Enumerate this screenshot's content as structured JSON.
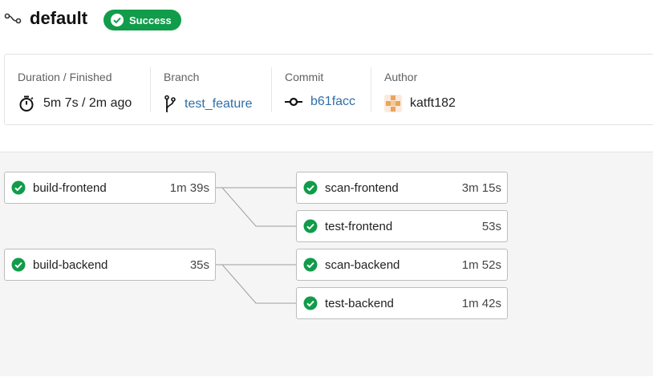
{
  "workflow": {
    "title": "default",
    "status_label": "Success"
  },
  "info": {
    "duration_label": "Duration / Finished",
    "duration_value": "5m 7s / 2m ago",
    "branch_label": "Branch",
    "branch_value": "test_feature",
    "commit_label": "Commit",
    "commit_value": "b61facc",
    "author_label": "Author",
    "author_value": "katft182"
  },
  "jobs": [
    {
      "name": "build-frontend",
      "duration": "1m 39s",
      "status": "success"
    },
    {
      "name": "scan-frontend",
      "duration": "3m 15s",
      "status": "success"
    },
    {
      "name": "test-frontend",
      "duration": "53s",
      "status": "success"
    },
    {
      "name": "build-backend",
      "duration": "35s",
      "status": "success"
    },
    {
      "name": "scan-backend",
      "duration": "1m 52s",
      "status": "success"
    },
    {
      "name": "test-backend",
      "duration": "1m 42s",
      "status": "success"
    }
  ],
  "colors": {
    "success": "#109c4a",
    "link": "#2f6fa8"
  }
}
